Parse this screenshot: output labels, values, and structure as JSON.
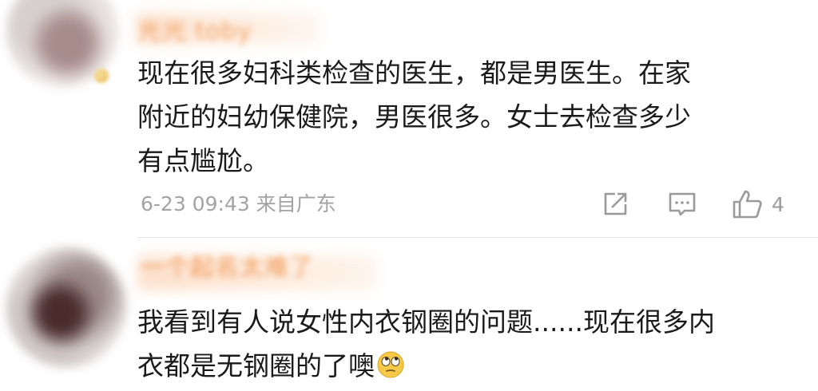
{
  "comments": [
    {
      "username": "光光 toby",
      "text_lines": [
        "现在很多妇科类检查的医生，都是男医生。在家",
        "附近的妇幼保健院，男医很多。女士去检查多少",
        "有点尴尬。"
      ],
      "meta": "6-23 09:43 来自广东",
      "like_count": "4",
      "icons": [
        "repost-icon",
        "comment-icon",
        "like-icon"
      ]
    },
    {
      "username": "一个起名太难了",
      "text_lines": [
        "我看到有人说女性内衣钢圈的问题......现在很多内",
        "衣都是无钢圈的了噢"
      ],
      "emoji": "eye-roll-emoji"
    }
  ],
  "colors": {
    "username": "#f08a3c",
    "meta": "#a3a3a3",
    "text": "#1a1a1a",
    "icon": "#9a9a9a",
    "divider": "#e6e6e6"
  }
}
